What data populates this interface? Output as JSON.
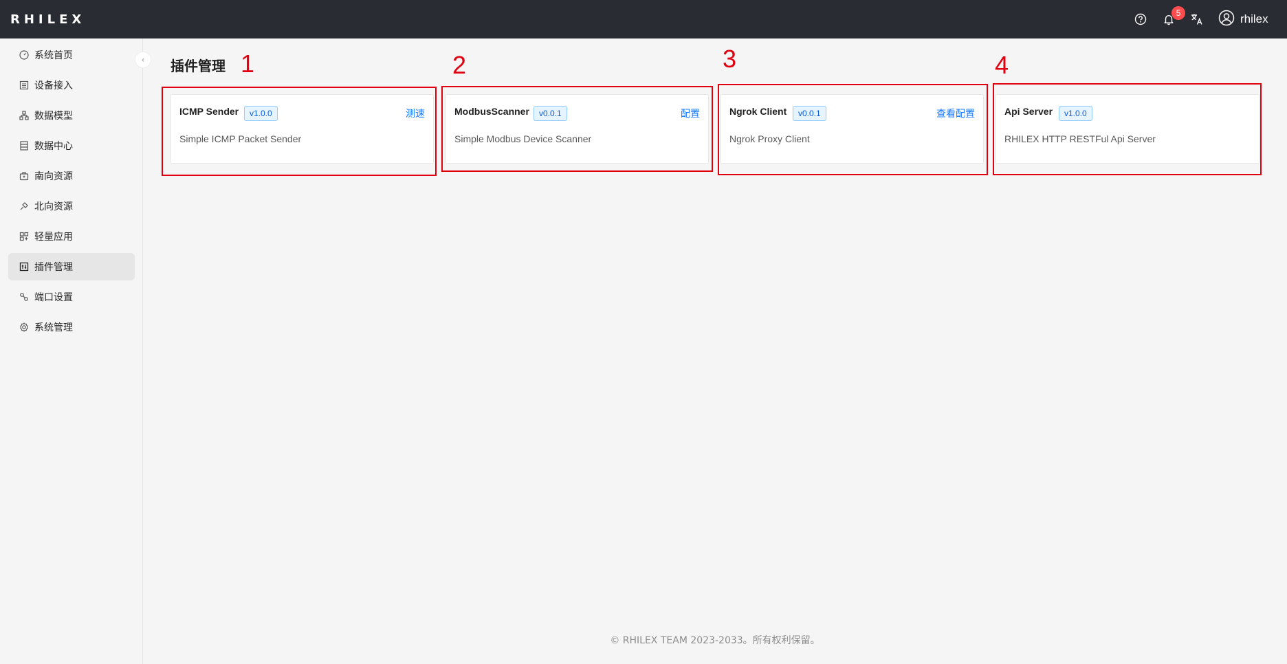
{
  "app": {
    "logo_text": "RHILEX"
  },
  "header": {
    "notification_count": "5",
    "username": "rhilex",
    "icons": [
      "help-icon",
      "bell-icon",
      "translate-icon",
      "user-icon"
    ]
  },
  "sidebar": {
    "items": [
      {
        "label": "系统首页",
        "icon": "dashboard-icon"
      },
      {
        "label": "设备接入",
        "icon": "device-icon"
      },
      {
        "label": "数据模型",
        "icon": "model-icon"
      },
      {
        "label": "数据中心",
        "icon": "database-icon"
      },
      {
        "label": "南向资源",
        "icon": "south-icon"
      },
      {
        "label": "北向资源",
        "icon": "north-icon"
      },
      {
        "label": "轻量应用",
        "icon": "apps-icon"
      },
      {
        "label": "插件管理",
        "icon": "plugin-icon",
        "active": true
      },
      {
        "label": "端口设置",
        "icon": "port-icon"
      },
      {
        "label": "系统管理",
        "icon": "gear-icon"
      }
    ]
  },
  "main": {
    "title": "插件管理",
    "cards": [
      {
        "name": "ICMP Sender",
        "version": "v1.0.0",
        "action": "测速",
        "description": "Simple ICMP Packet Sender",
        "annotation": "1"
      },
      {
        "name": "ModbusScanner",
        "version": "v0.0.1",
        "action": "配置",
        "description": "Simple Modbus Device Scanner",
        "annotation": "2"
      },
      {
        "name": "Ngrok Client",
        "version": "v0.0.1",
        "action": "查看配置",
        "description": "Ngrok Proxy Client",
        "annotation": "3"
      },
      {
        "name": "Api Server",
        "version": "v1.0.0",
        "action": "",
        "description": "RHILEX HTTP RESTFul Api Server",
        "annotation": "4"
      }
    ]
  },
  "footer": {
    "text": "RHILEX TEAM 2023-2033。所有权利保留。"
  },
  "colors": {
    "header_bg": "#292c33",
    "accent": "#1677ff",
    "annotation_red": "#e0000f",
    "badge_red": "#ff4d4f"
  }
}
